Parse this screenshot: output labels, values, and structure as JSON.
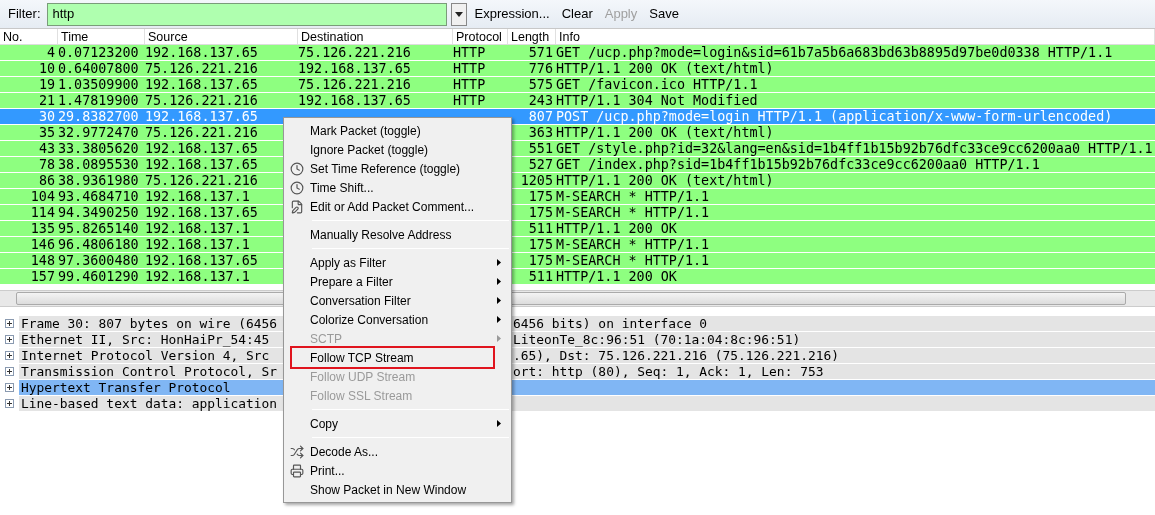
{
  "filter_bar": {
    "label": "Filter:",
    "value": "http",
    "buttons": [
      {
        "label": "Expression...",
        "disabled": false
      },
      {
        "label": "Clear",
        "disabled": false
      },
      {
        "label": "Apply",
        "disabled": true
      },
      {
        "label": "Save",
        "disabled": false
      }
    ]
  },
  "packet_list": {
    "columns": [
      "No.",
      "Time",
      "Source",
      "Destination",
      "Protocol",
      "Length",
      "Info"
    ],
    "rows": [
      {
        "no": "4",
        "time": "0.07123200",
        "source": "192.168.137.65",
        "destination": "75.126.221.216",
        "protocol": "HTTP",
        "length": "571",
        "info": "GET /ucp.php?mode=login&sid=61b7a5b6a683bd63b8895d97be0d0338 HTTP/1.1",
        "selected": false
      },
      {
        "no": "10",
        "time": "0.64007800",
        "source": "75.126.221.216",
        "destination": "192.168.137.65",
        "protocol": "HTTP",
        "length": "776",
        "info": "HTTP/1.1 200 OK  (text/html)",
        "selected": false
      },
      {
        "no": "19",
        "time": "1.03509900",
        "source": "192.168.137.65",
        "destination": "75.126.221.216",
        "protocol": "HTTP",
        "length": "575",
        "info": "GET /favicon.ico HTTP/1.1",
        "selected": false
      },
      {
        "no": "21",
        "time": "1.47819900",
        "source": "75.126.221.216",
        "destination": "192.168.137.65",
        "protocol": "HTTP",
        "length": "243",
        "info": "HTTP/1.1 304 Not Modified",
        "selected": false
      },
      {
        "no": "30",
        "time": "29.8382700",
        "source": "192.168.137.65",
        "length": "807",
        "info": "POST /ucp.php?mode=login HTTP/1.1  (application/x-www-form-urlencoded)",
        "selected": true
      },
      {
        "no": "35",
        "time": "32.9772470",
        "source": "75.126.221.216",
        "length": "363",
        "info": "HTTP/1.1 200 OK  (text/html)",
        "selected": false
      },
      {
        "no": "43",
        "time": "33.3805620",
        "source": "192.168.137.65",
        "length": "551",
        "info": "GET /style.php?id=32&lang=en&sid=1b4ff1b15b92b76dfc33ce9cc6200aa0 HTTP/1.1",
        "selected": false
      },
      {
        "no": "78",
        "time": "38.0895530",
        "source": "192.168.137.65",
        "length": "527",
        "info": "GET /index.php?sid=1b4ff1b15b92b76dfc33ce9cc6200aa0 HTTP/1.1",
        "selected": false
      },
      {
        "no": "86",
        "time": "38.9361980",
        "source": "75.126.221.216",
        "length": "1205",
        "info": "HTTP/1.1 200 OK  (text/html)",
        "selected": false
      },
      {
        "no": "104",
        "time": "93.4684710",
        "source": "192.168.137.1",
        "length": "175",
        "info": "M-SEARCH * HTTP/1.1",
        "selected": false
      },
      {
        "no": "114",
        "time": "94.3490250",
        "source": "192.168.137.65",
        "length": "175",
        "info": "M-SEARCH * HTTP/1.1",
        "selected": false
      },
      {
        "no": "135",
        "time": "95.8265140",
        "source": "192.168.137.1",
        "length": "511",
        "info": "HTTP/1.1 200 OK",
        "selected": false
      },
      {
        "no": "146",
        "time": "96.4806180",
        "source": "192.168.137.1",
        "length": "175",
        "info": "M-SEARCH * HTTP/1.1",
        "selected": false
      },
      {
        "no": "148",
        "time": "97.3600480",
        "source": "192.168.137.65",
        "length": "175",
        "info": "M-SEARCH * HTTP/1.1",
        "selected": false
      },
      {
        "no": "157",
        "time": "99.4601290",
        "source": "192.168.137.1",
        "length": "511",
        "info": "HTTP/1.1 200 OK",
        "selected": false
      }
    ]
  },
  "details": [
    {
      "text": "Frame 30: 807 bytes on wire (6456",
      "text_right": "6456 bits) on interface 0",
      "selected": false
    },
    {
      "text": "Ethernet II, Src: HonHaiPr_54:45",
      "text_right": "LiteonTe_8c:96:51 (70:1a:04:8c:96:51)",
      "selected": false
    },
    {
      "text": "Internet Protocol Version 4, Src",
      "text_right": ".65), Dst: 75.126.221.216 (75.126.221.216)",
      "selected": false
    },
    {
      "text": "Transmission Control Protocol, Sr",
      "text_right": "ort: http (80), Seq: 1, Ack: 1, Len: 753",
      "selected": false
    },
    {
      "text": "Hypertext Transfer Protocol",
      "selected": true
    },
    {
      "text": "Line-based text data: application",
      "selected": false
    }
  ],
  "context_menu": [
    {
      "kind": "item",
      "label": "Mark Packet (toggle)",
      "disabled": false,
      "submenu": false
    },
    {
      "kind": "item",
      "label": "Ignore Packet (toggle)",
      "disabled": false,
      "submenu": false
    },
    {
      "kind": "item",
      "label": "Set Time Reference (toggle)",
      "disabled": false,
      "submenu": false
    },
    {
      "kind": "item",
      "label": "Time Shift...",
      "disabled": false,
      "submenu": false
    },
    {
      "kind": "item",
      "label": "Edit or Add Packet Comment...",
      "disabled": false,
      "submenu": false
    },
    {
      "kind": "separator"
    },
    {
      "kind": "item",
      "label": "Manually Resolve Address",
      "disabled": false,
      "submenu": false
    },
    {
      "kind": "separator"
    },
    {
      "kind": "item",
      "label": "Apply as Filter",
      "disabled": false,
      "submenu": true
    },
    {
      "kind": "item",
      "label": "Prepare a Filter",
      "disabled": false,
      "submenu": true
    },
    {
      "kind": "item",
      "label": "Conversation Filter",
      "disabled": false,
      "submenu": true
    },
    {
      "kind": "item",
      "label": "Colorize Conversation",
      "disabled": false,
      "submenu": true
    },
    {
      "kind": "item",
      "label": "SCTP",
      "disabled": true,
      "submenu": true
    },
    {
      "kind": "item",
      "label": "Follow TCP Stream",
      "disabled": false,
      "submenu": false,
      "outlined": true
    },
    {
      "kind": "item",
      "label": "Follow UDP Stream",
      "disabled": true,
      "submenu": false
    },
    {
      "kind": "item",
      "label": "Follow SSL Stream",
      "disabled": true,
      "submenu": false
    },
    {
      "kind": "separator"
    },
    {
      "kind": "item",
      "label": "Copy",
      "disabled": false,
      "submenu": true
    },
    {
      "kind": "separator"
    },
    {
      "kind": "item",
      "label": "Decode As...",
      "disabled": false,
      "submenu": false
    },
    {
      "kind": "item",
      "label": "Print...",
      "disabled": false,
      "submenu": false
    },
    {
      "kind": "item",
      "label": "Show Packet in New Window",
      "disabled": false,
      "submenu": false
    }
  ]
}
